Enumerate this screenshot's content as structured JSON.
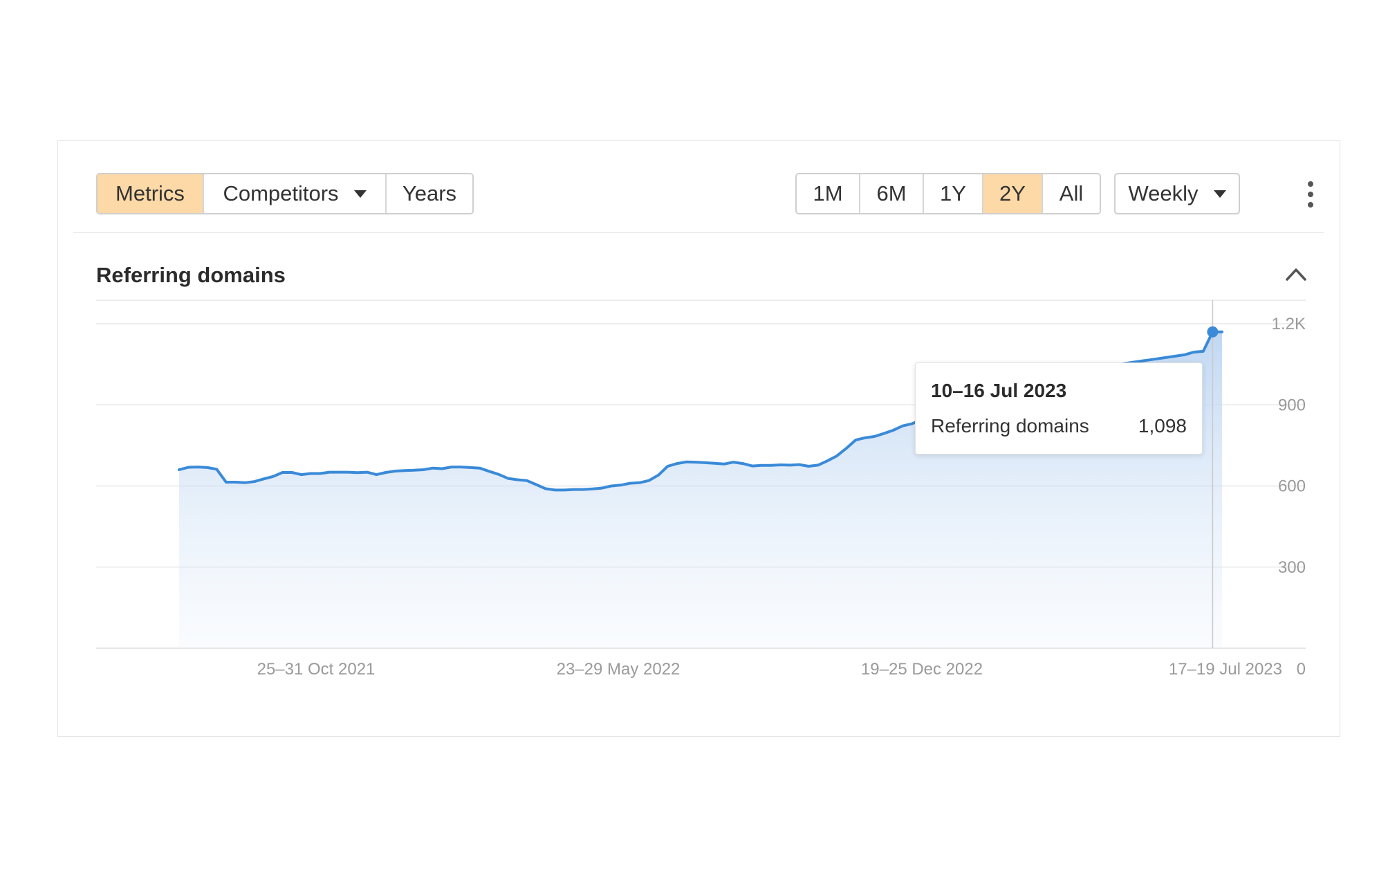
{
  "toolbar": {
    "view_tabs": [
      {
        "label": "Metrics",
        "active": true
      },
      {
        "label": "Competitors",
        "active": false,
        "has_dropdown": true
      },
      {
        "label": "Years",
        "active": false
      }
    ],
    "range_tabs": [
      {
        "label": "1M",
        "active": false
      },
      {
        "label": "6M",
        "active": false
      },
      {
        "label": "1Y",
        "active": false
      },
      {
        "label": "2Y",
        "active": true
      },
      {
        "label": "All",
        "active": false
      }
    ],
    "interval_select": "Weekly",
    "more_icon": "kebab-menu-icon"
  },
  "section": {
    "title": "Referring domains",
    "collapse_icon": "chevron-up-icon"
  },
  "tooltip": {
    "date": "10–16 Jul 2023",
    "label": "Referring domains",
    "value": "1,098"
  },
  "colors": {
    "accent_active": "#fcd9a6",
    "line": "#3a8ad8",
    "area": "#cfe0f5"
  },
  "chart_data": {
    "type": "area",
    "title": "Referring domains",
    "series": [
      {
        "name": "Referring domains",
        "values": [
          660,
          669,
          670,
          668,
          662,
          614,
          614,
          612,
          616,
          626,
          635,
          650,
          650,
          642,
          646,
          646,
          651,
          651,
          651,
          649,
          651,
          642,
          650,
          655,
          657,
          658,
          660,
          666,
          664,
          670,
          670,
          668,
          666,
          654,
          643,
          628,
          623,
          620,
          605,
          590,
          585,
          585,
          587,
          587,
          589,
          592,
          600,
          603,
          610,
          612,
          620,
          640,
          673,
          683,
          689,
          688,
          686,
          684,
          681,
          688,
          683,
          674,
          676,
          676,
          678,
          677,
          679,
          673,
          677,
          693,
          711,
          739,
          770,
          778,
          783,
          794,
          806,
          822,
          830,
          845,
          860,
          870,
          880,
          890,
          900,
          910,
          920,
          930,
          940,
          950,
          960,
          975,
          985,
          995,
          1005,
          1015,
          1025,
          1030,
          1040,
          1045,
          1050,
          1055,
          1060,
          1065,
          1070,
          1075,
          1080,
          1085,
          1095,
          1098,
          1170,
          1170
        ]
      }
    ],
    "x_tick_labels": [
      "25–31 Oct 2021",
      "23–29 May 2022",
      "19–25 Dec 2022",
      "17–19 Jul 2023"
    ],
    "y_ticks": [
      0,
      300,
      600,
      900,
      1200
    ],
    "y_tick_labels": [
      "0",
      "300",
      "600",
      "900",
      "1.2K"
    ],
    "ylim": [
      0,
      1200
    ],
    "grid": true,
    "highlighted_point": {
      "label": "10–16 Jul 2023",
      "value": 1098
    }
  }
}
